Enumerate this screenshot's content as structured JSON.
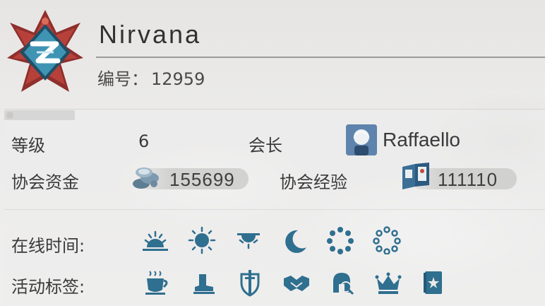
{
  "header": {
    "guild_name": "Nirvana",
    "id_label": "编号：",
    "id_value": "12959"
  },
  "info": {
    "level_label": "等级",
    "level_value": "6",
    "leader_label": "会长",
    "leader_name": "Raffaello",
    "funds_label": "协会资金",
    "funds_value": "155699",
    "exp_label": "协会经验",
    "exp_value": "111110"
  },
  "online": {
    "label": "在线时间:",
    "icons": [
      "sunrise-icon",
      "sun-icon",
      "sunset-icon",
      "moon-icon",
      "dotted-circle-icon",
      "hollow-dotted-circle-icon"
    ]
  },
  "activity": {
    "label": "活动标签:",
    "icons": [
      "coffee-cup-icon",
      "boot-icon",
      "shield-sword-icon",
      "handshake-icon",
      "spartan-helmet-icon",
      "crown-icon",
      "card-book-icon"
    ]
  },
  "colors": {
    "icon_blue": "#2f6f8f",
    "emblem_red": "#a33a36",
    "emblem_teal": "#3f94b3"
  }
}
